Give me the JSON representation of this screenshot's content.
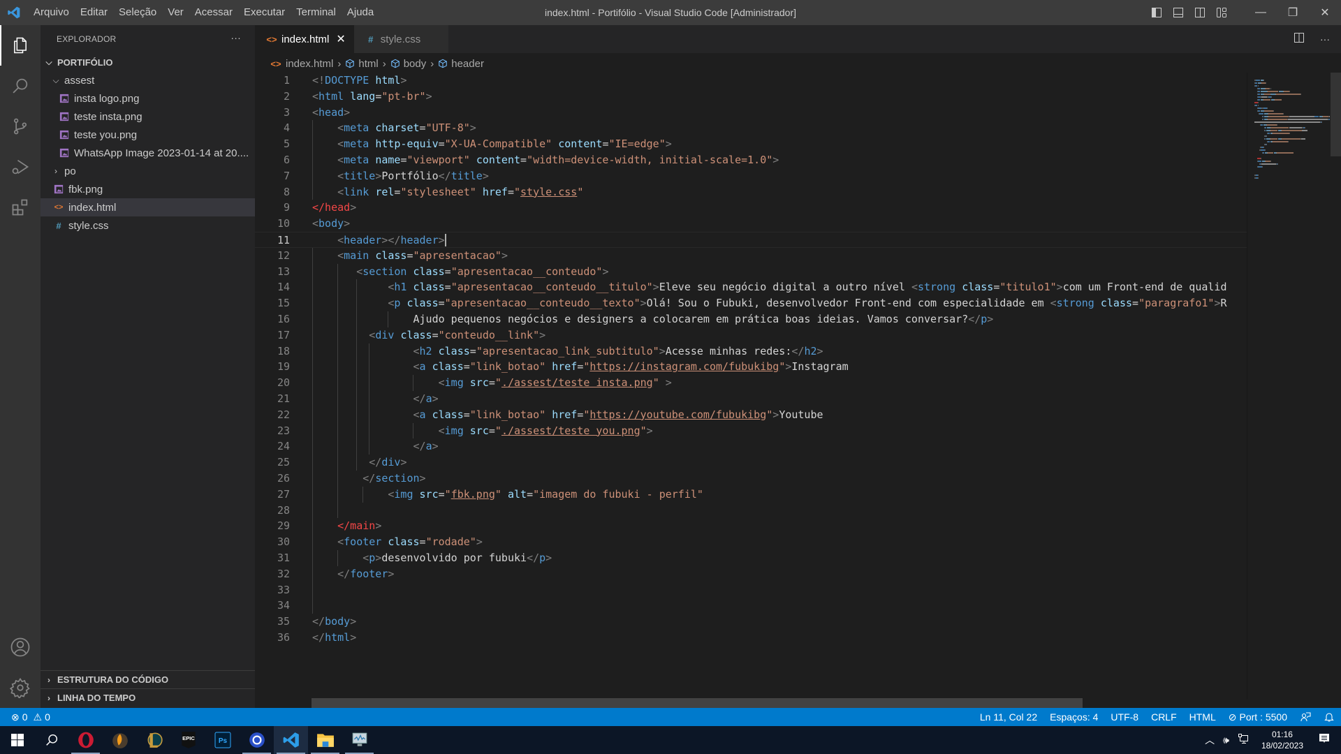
{
  "titlebar": {
    "app_icon": "vscode-logo-icon",
    "menu": [
      "Arquivo",
      "Editar",
      "Seleção",
      "Ver",
      "Acessar",
      "Executar",
      "Terminal",
      "Ajuda"
    ],
    "title": "index.html - Portifólio - Visual Studio Code [Administrador]",
    "layout_buttons": [
      "toggle-primary-sidebar-icon",
      "toggle-panel-icon",
      "toggle-secondary-sidebar-icon",
      "customize-layout-icon"
    ],
    "window_buttons": {
      "minimize": "—",
      "restore": "❐",
      "close": "✕"
    }
  },
  "activity_bar": {
    "items": [
      "explorer-icon",
      "search-icon",
      "source-control-icon",
      "run-debug-icon",
      "extensions-icon"
    ],
    "bottom": [
      "accounts-icon",
      "manage-gear-icon"
    ]
  },
  "sidebar": {
    "title": "EXPLORADOR",
    "more": "···",
    "root": "PORTIFÓLIO",
    "tree": [
      {
        "label": "assest",
        "type": "folder",
        "expanded": true,
        "depth": 1
      },
      {
        "label": "insta logo.png",
        "type": "image",
        "depth": 2
      },
      {
        "label": "teste insta.png",
        "type": "image",
        "depth": 2
      },
      {
        "label": "teste you.png",
        "type": "image",
        "depth": 2
      },
      {
        "label": "WhatsApp Image 2023-01-14 at 20....",
        "type": "image",
        "depth": 2
      },
      {
        "label": "po",
        "type": "folder",
        "expanded": false,
        "depth": 1
      },
      {
        "label": "fbk.png",
        "type": "image",
        "depth": 1
      },
      {
        "label": "index.html",
        "type": "html",
        "depth": 1,
        "selected": true
      },
      {
        "label": "style.css",
        "type": "css",
        "depth": 1
      }
    ],
    "sections": [
      "ESTRUTURA DO CÓDIGO",
      "LINHA DO TEMPO"
    ]
  },
  "tabs": [
    {
      "label": "index.html",
      "icon": "<>",
      "active": true,
      "close": "✕"
    },
    {
      "label": "style.css",
      "icon": "#",
      "active": false
    }
  ],
  "breadcrumb": [
    "index.html",
    "html",
    "body",
    "header"
  ],
  "editor": {
    "current_line": 11,
    "lines": [
      [
        [
          "br",
          "<!"
        ],
        [
          "tag",
          "DOCTYPE"
        ],
        [
          "txt",
          " "
        ],
        [
          "attr",
          "html"
        ],
        [
          "br",
          ">"
        ]
      ],
      [
        [
          "br",
          "<"
        ],
        [
          "tag",
          "html"
        ],
        [
          "txt",
          " "
        ],
        [
          "attr",
          "lang"
        ],
        [
          "txt",
          "="
        ],
        [
          "str",
          "\"pt-br\""
        ],
        [
          "br",
          ">"
        ]
      ],
      [
        [
          "br",
          "<"
        ],
        [
          "tag",
          "head"
        ],
        [
          "br",
          ">"
        ]
      ],
      [
        [
          "txt",
          "    "
        ],
        [
          "br",
          "<"
        ],
        [
          "tag",
          "meta"
        ],
        [
          "txt",
          " "
        ],
        [
          "attr",
          "charset"
        ],
        [
          "txt",
          "="
        ],
        [
          "str",
          "\"UTF-8\""
        ],
        [
          "br",
          ">"
        ]
      ],
      [
        [
          "txt",
          "    "
        ],
        [
          "br",
          "<"
        ],
        [
          "tag",
          "meta"
        ],
        [
          "txt",
          " "
        ],
        [
          "attr",
          "http-equiv"
        ],
        [
          "txt",
          "="
        ],
        [
          "str",
          "\"X-UA-Compatible\""
        ],
        [
          "txt",
          " "
        ],
        [
          "attr",
          "content"
        ],
        [
          "txt",
          "="
        ],
        [
          "str",
          "\"IE=edge\""
        ],
        [
          "br",
          ">"
        ]
      ],
      [
        [
          "txt",
          "    "
        ],
        [
          "br",
          "<"
        ],
        [
          "tag",
          "meta"
        ],
        [
          "txt",
          " "
        ],
        [
          "attr",
          "name"
        ],
        [
          "txt",
          "="
        ],
        [
          "str",
          "\"viewport\""
        ],
        [
          "txt",
          " "
        ],
        [
          "attr",
          "content"
        ],
        [
          "txt",
          "="
        ],
        [
          "str",
          "\"width=device-width, initial-scale=1.0\""
        ],
        [
          "br",
          ">"
        ]
      ],
      [
        [
          "txt",
          "    "
        ],
        [
          "br",
          "<"
        ],
        [
          "tag",
          "title"
        ],
        [
          "br",
          ">"
        ],
        [
          "txt",
          "Portfólio"
        ],
        [
          "br",
          "</"
        ],
        [
          "tag",
          "title"
        ],
        [
          "br",
          ">"
        ]
      ],
      [
        [
          "txt",
          "    "
        ],
        [
          "br",
          "<"
        ],
        [
          "tag",
          "link"
        ],
        [
          "txt",
          " "
        ],
        [
          "attr",
          "rel"
        ],
        [
          "txt",
          "="
        ],
        [
          "str",
          "\"stylesheet\""
        ],
        [
          "txt",
          " "
        ],
        [
          "attr",
          "href"
        ],
        [
          "txt",
          "="
        ],
        [
          "str",
          "\""
        ],
        [
          "link",
          "style.css"
        ],
        [
          "str",
          "\""
        ]
      ],
      [
        [
          "red",
          "</head"
        ],
        [
          "br",
          ">"
        ]
      ],
      [
        [
          "br",
          "<"
        ],
        [
          "tag",
          "body"
        ],
        [
          "br",
          ">"
        ]
      ],
      [
        [
          "txt",
          "    "
        ],
        [
          "br",
          "<"
        ],
        [
          "tag",
          "header"
        ],
        [
          "br",
          "></"
        ],
        [
          "tag",
          "header"
        ],
        [
          "br",
          ">"
        ],
        [
          "cursor",
          ""
        ]
      ],
      [
        [
          "txt",
          "    "
        ],
        [
          "br",
          "<"
        ],
        [
          "tag",
          "main"
        ],
        [
          "txt",
          " "
        ],
        [
          "attr",
          "class"
        ],
        [
          "txt",
          "="
        ],
        [
          "str",
          "\"apresentacao\""
        ],
        [
          "br",
          ">"
        ]
      ],
      [
        [
          "txt",
          "       "
        ],
        [
          "br",
          "<"
        ],
        [
          "tag",
          "section"
        ],
        [
          "txt",
          " "
        ],
        [
          "attr",
          "class"
        ],
        [
          "txt",
          "="
        ],
        [
          "str",
          "\"apresentacao__conteudo\""
        ],
        [
          "br",
          ">"
        ]
      ],
      [
        [
          "txt",
          "            "
        ],
        [
          "br",
          "<"
        ],
        [
          "tag",
          "h1"
        ],
        [
          "txt",
          " "
        ],
        [
          "attr",
          "class"
        ],
        [
          "txt",
          "="
        ],
        [
          "str",
          "\"apresentacao__conteudo__titulo\""
        ],
        [
          "br",
          ">"
        ],
        [
          "txt",
          "Eleve seu negócio digital a outro nível "
        ],
        [
          "br",
          "<"
        ],
        [
          "tag",
          "strong"
        ],
        [
          "txt",
          " "
        ],
        [
          "attr",
          "class"
        ],
        [
          "txt",
          "="
        ],
        [
          "str",
          "\"titulo1\""
        ],
        [
          "br",
          ">"
        ],
        [
          "txt",
          "com um Front-end de qualid"
        ]
      ],
      [
        [
          "txt",
          "            "
        ],
        [
          "br",
          "<"
        ],
        [
          "tag",
          "p"
        ],
        [
          "txt",
          " "
        ],
        [
          "attr",
          "class"
        ],
        [
          "txt",
          "="
        ],
        [
          "str",
          "\"apresentacao__conteudo__texto\""
        ],
        [
          "br",
          ">"
        ],
        [
          "txt",
          "Olá! Sou o Fubuki, desenvolvedor Front-end com especialidade em "
        ],
        [
          "br",
          "<"
        ],
        [
          "tag",
          "strong"
        ],
        [
          "txt",
          " "
        ],
        [
          "attr",
          "class"
        ],
        [
          "txt",
          "="
        ],
        [
          "str",
          "\"paragrafo1\""
        ],
        [
          "br",
          ">"
        ],
        [
          "txt",
          "R"
        ]
      ],
      [
        [
          "txt",
          "                Ajudo pequenos negócios e designers a colocarem em prática boas ideias. Vamos conversar?"
        ],
        [
          "br",
          "</"
        ],
        [
          "tag",
          "p"
        ],
        [
          "br",
          ">"
        ]
      ],
      [
        [
          "txt",
          "         "
        ],
        [
          "br",
          "<"
        ],
        [
          "tag",
          "div"
        ],
        [
          "txt",
          " "
        ],
        [
          "attr",
          "class"
        ],
        [
          "txt",
          "="
        ],
        [
          "str",
          "\"conteudo__link\""
        ],
        [
          "br",
          ">"
        ]
      ],
      [
        [
          "txt",
          "                "
        ],
        [
          "br",
          "<"
        ],
        [
          "tag",
          "h2"
        ],
        [
          "txt",
          " "
        ],
        [
          "attr",
          "class"
        ],
        [
          "txt",
          "="
        ],
        [
          "str",
          "\"apresentacao_link_subtitulo\""
        ],
        [
          "br",
          ">"
        ],
        [
          "txt",
          "Acesse minhas redes:"
        ],
        [
          "br",
          "</"
        ],
        [
          "tag",
          "h2"
        ],
        [
          "br",
          ">"
        ]
      ],
      [
        [
          "txt",
          "                "
        ],
        [
          "br",
          "<"
        ],
        [
          "tag",
          "a"
        ],
        [
          "txt",
          " "
        ],
        [
          "attr",
          "class"
        ],
        [
          "txt",
          "="
        ],
        [
          "str",
          "\"link_botao\""
        ],
        [
          "txt",
          " "
        ],
        [
          "attr",
          "href"
        ],
        [
          "txt",
          "="
        ],
        [
          "str",
          "\""
        ],
        [
          "link",
          "https://instagram.com/fubukibg"
        ],
        [
          "str",
          "\""
        ],
        [
          "br",
          ">"
        ],
        [
          "txt",
          "Instagram"
        ]
      ],
      [
        [
          "txt",
          "                    "
        ],
        [
          "br",
          "<"
        ],
        [
          "tag",
          "img"
        ],
        [
          "txt",
          " "
        ],
        [
          "attr",
          "src"
        ],
        [
          "txt",
          "="
        ],
        [
          "str",
          "\""
        ],
        [
          "link",
          "./assest/teste insta.png"
        ],
        [
          "str",
          "\""
        ],
        [
          "txt",
          " "
        ],
        [
          "br",
          ">"
        ]
      ],
      [
        [
          "txt",
          "                "
        ],
        [
          "br",
          "</"
        ],
        [
          "tag",
          "a"
        ],
        [
          "br",
          ">"
        ]
      ],
      [
        [
          "txt",
          "                "
        ],
        [
          "br",
          "<"
        ],
        [
          "tag",
          "a"
        ],
        [
          "txt",
          " "
        ],
        [
          "attr",
          "class"
        ],
        [
          "txt",
          "="
        ],
        [
          "str",
          "\"link_botao\""
        ],
        [
          "txt",
          " "
        ],
        [
          "attr",
          "href"
        ],
        [
          "txt",
          "="
        ],
        [
          "str",
          "\""
        ],
        [
          "link",
          "https://youtube.com/fubukibg"
        ],
        [
          "str",
          "\""
        ],
        [
          "br",
          ">"
        ],
        [
          "txt",
          "Youtube"
        ]
      ],
      [
        [
          "txt",
          "                    "
        ],
        [
          "br",
          "<"
        ],
        [
          "tag",
          "img"
        ],
        [
          "txt",
          " "
        ],
        [
          "attr",
          "src"
        ],
        [
          "txt",
          "="
        ],
        [
          "str",
          "\""
        ],
        [
          "link",
          "./assest/teste you.png"
        ],
        [
          "str",
          "\""
        ],
        [
          "br",
          ">"
        ]
      ],
      [
        [
          "txt",
          "                "
        ],
        [
          "br",
          "</"
        ],
        [
          "tag",
          "a"
        ],
        [
          "br",
          ">"
        ]
      ],
      [
        [
          "txt",
          "         "
        ],
        [
          "br",
          "</"
        ],
        [
          "tag",
          "div"
        ],
        [
          "br",
          ">"
        ]
      ],
      [
        [
          "txt",
          "        "
        ],
        [
          "br",
          "</"
        ],
        [
          "tag",
          "section"
        ],
        [
          "br",
          ">"
        ]
      ],
      [
        [
          "txt",
          "            "
        ],
        [
          "br",
          "<"
        ],
        [
          "tag",
          "img"
        ],
        [
          "txt",
          " "
        ],
        [
          "attr",
          "src"
        ],
        [
          "txt",
          "="
        ],
        [
          "str",
          "\""
        ],
        [
          "link",
          "fbk.png"
        ],
        [
          "str",
          "\""
        ],
        [
          "txt",
          " "
        ],
        [
          "attr",
          "alt"
        ],
        [
          "txt",
          "="
        ],
        [
          "str",
          "\"imagem do fubuki - perfil\""
        ]
      ],
      [],
      [
        [
          "txt",
          "    "
        ],
        [
          "red",
          "</main"
        ],
        [
          "br",
          ">"
        ]
      ],
      [
        [
          "txt",
          "    "
        ],
        [
          "br",
          "<"
        ],
        [
          "tag",
          "footer"
        ],
        [
          "txt",
          " "
        ],
        [
          "attr",
          "class"
        ],
        [
          "txt",
          "="
        ],
        [
          "str",
          "\"rodade\""
        ],
        [
          "br",
          ">"
        ]
      ],
      [
        [
          "txt",
          "        "
        ],
        [
          "br",
          "<"
        ],
        [
          "tag",
          "p"
        ],
        [
          "br",
          ">"
        ],
        [
          "txt",
          "desenvolvido por fubuki"
        ],
        [
          "br",
          "</"
        ],
        [
          "tag",
          "p"
        ],
        [
          "br",
          ">"
        ]
      ],
      [
        [
          "txt",
          "    "
        ],
        [
          "br",
          "</"
        ],
        [
          "tag",
          "footer"
        ],
        [
          "br",
          ">"
        ]
      ],
      [],
      [],
      [
        [
          "br",
          "</"
        ],
        [
          "tag",
          "body"
        ],
        [
          "br",
          ">"
        ]
      ],
      [
        [
          "br",
          "</"
        ],
        [
          "tag",
          "html"
        ],
        [
          "br",
          ">"
        ]
      ]
    ]
  },
  "statusbar": {
    "errors": "0",
    "warnings": "0",
    "position": "Ln 11, Col 22",
    "indent": "Espaços: 4",
    "encoding": "UTF-8",
    "eol": "CRLF",
    "language": "HTML",
    "live_server": "Port : 5500"
  },
  "taskbar": {
    "apps": [
      "windows-start-icon",
      "search-icon",
      "opera-icon",
      "fl-studio-icon",
      "league-of-legends-icon",
      "epic-games-icon",
      "photoshop-icon",
      "settings-app-icon",
      "vscode-icon",
      "file-explorer-icon",
      "resource-monitor-icon"
    ],
    "clock_time": "01:16",
    "clock_date": "18/02/2023"
  },
  "colors": {
    "accent": "#007acc",
    "html_icon": "#e37933",
    "css_icon": "#519aba",
    "image_icon": "#a074c4"
  }
}
